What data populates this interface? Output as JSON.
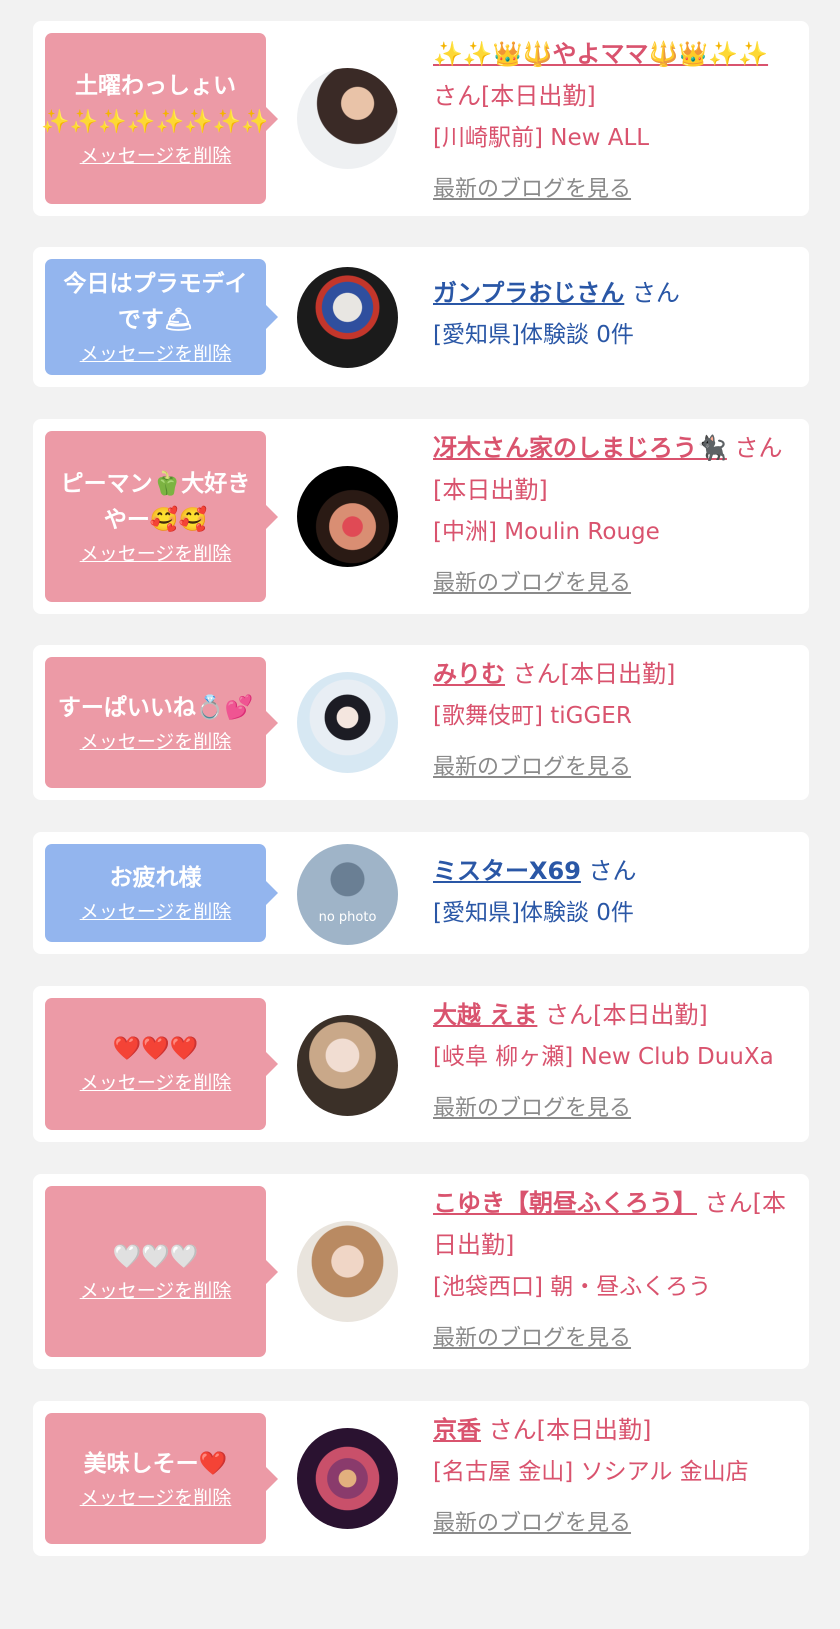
{
  "delete_label": "メッセージを削除",
  "blog_label": "最新のブログを見る",
  "san_label": "さん",
  "today_label": "さん[本日出勤]",
  "colors": {
    "pink_bubble": "#ec9aa6",
    "blue_bubble": "#93b5ee",
    "pink_text": "#d9536e",
    "blue_text": "#2a57a6"
  },
  "messages": [
    {
      "bubble": "土曜わっしょい ✨✨✨✨✨✨✨✨",
      "name": "✨✨👑🔱やよママ🔱👑✨✨",
      "suffix": "さん[本日出勤]",
      "shop": "[川崎駅前] New ALL",
      "blog": true
    },
    {
      "bubble": "今日はプラモデイです🛎",
      "name": "ガンプラおじさん",
      "suffix": "さん",
      "shop": "[愛知県]体験談 0件",
      "blog": false
    },
    {
      "bubble": "ピーマン🫑大好きやー🥰🥰",
      "name": "冴木さん家のしまじろう🐈‍⬛",
      "suffix": "さん[本日出勤]",
      "shop": "[中洲] Moulin Rouge",
      "blog": true
    },
    {
      "bubble": "すーぱいいね💍💕",
      "name": "みりむ",
      "suffix": "さん[本日出勤]",
      "shop": "[歌舞伎町] tiGGER",
      "blog": true
    },
    {
      "bubble": "お疲れ様",
      "name": "ミスターX69",
      "suffix": "さん",
      "shop": "[愛知県]体験談 0件",
      "blog": false,
      "avatar_text": "no photo"
    },
    {
      "bubble": "❤️❤️❤️",
      "name": "大越 えま",
      "suffix": "さん[本日出勤]",
      "shop": "[岐阜 柳ヶ瀬] New Club DuuXa",
      "blog": true
    },
    {
      "bubble": "🤍🤍🤍",
      "name": "こゆき【朝昼ふくろう】",
      "suffix": "さん[本日出勤]",
      "shop": "[池袋西口] 朝・昼ふくろう",
      "blog": true
    },
    {
      "bubble": "美味しそー❤️",
      "name": "京香",
      "suffix": "さん[本日出勤]",
      "shop": "[名古屋 金山] ソシアル 金山店",
      "blog": true
    }
  ]
}
